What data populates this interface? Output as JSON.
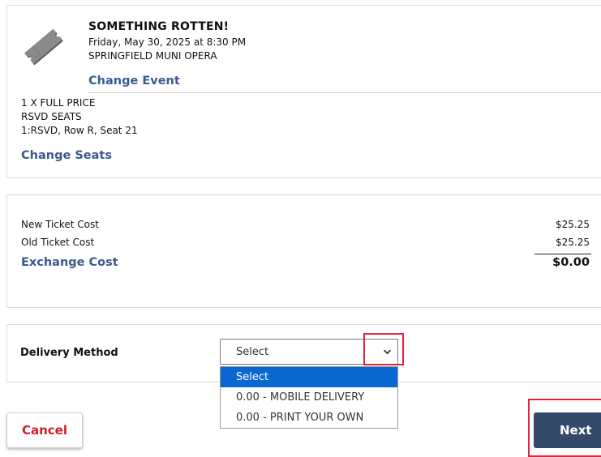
{
  "event": {
    "title": "SOMETHING ROTTEN!",
    "datetime": "Friday, May 30, 2025 at 8:30 PM",
    "venue": "SPRINGFIELD MUNI OPERA",
    "change_event_label": "Change Event",
    "ticket_icon": "ticket-icon"
  },
  "seats": {
    "lines": [
      "1 X FULL PRICE",
      "RSVD SEATS",
      "1:RSVD, Row R, Seat 21"
    ],
    "change_seats_label": "Change Seats"
  },
  "costs": {
    "new_ticket_label": "New Ticket Cost",
    "new_ticket_value": "$25.25",
    "old_ticket_label": "Old Ticket Cost",
    "old_ticket_value": "$25.25",
    "exchange_label": "Exchange Cost",
    "exchange_value": "$0.00"
  },
  "delivery": {
    "label": "Delivery Method",
    "selected": "Select",
    "options": [
      "Select",
      "0.00 - MOBILE DELIVERY",
      "0.00 - PRINT YOUR OWN"
    ]
  },
  "actions": {
    "cancel_label": "Cancel",
    "next_label": "Next"
  },
  "colors": {
    "link": "#3a5a8c",
    "cancel_text": "#cc2030",
    "next_bg": "#33496a",
    "highlight": "#e0263a",
    "option_selected": "#0a67d0"
  }
}
